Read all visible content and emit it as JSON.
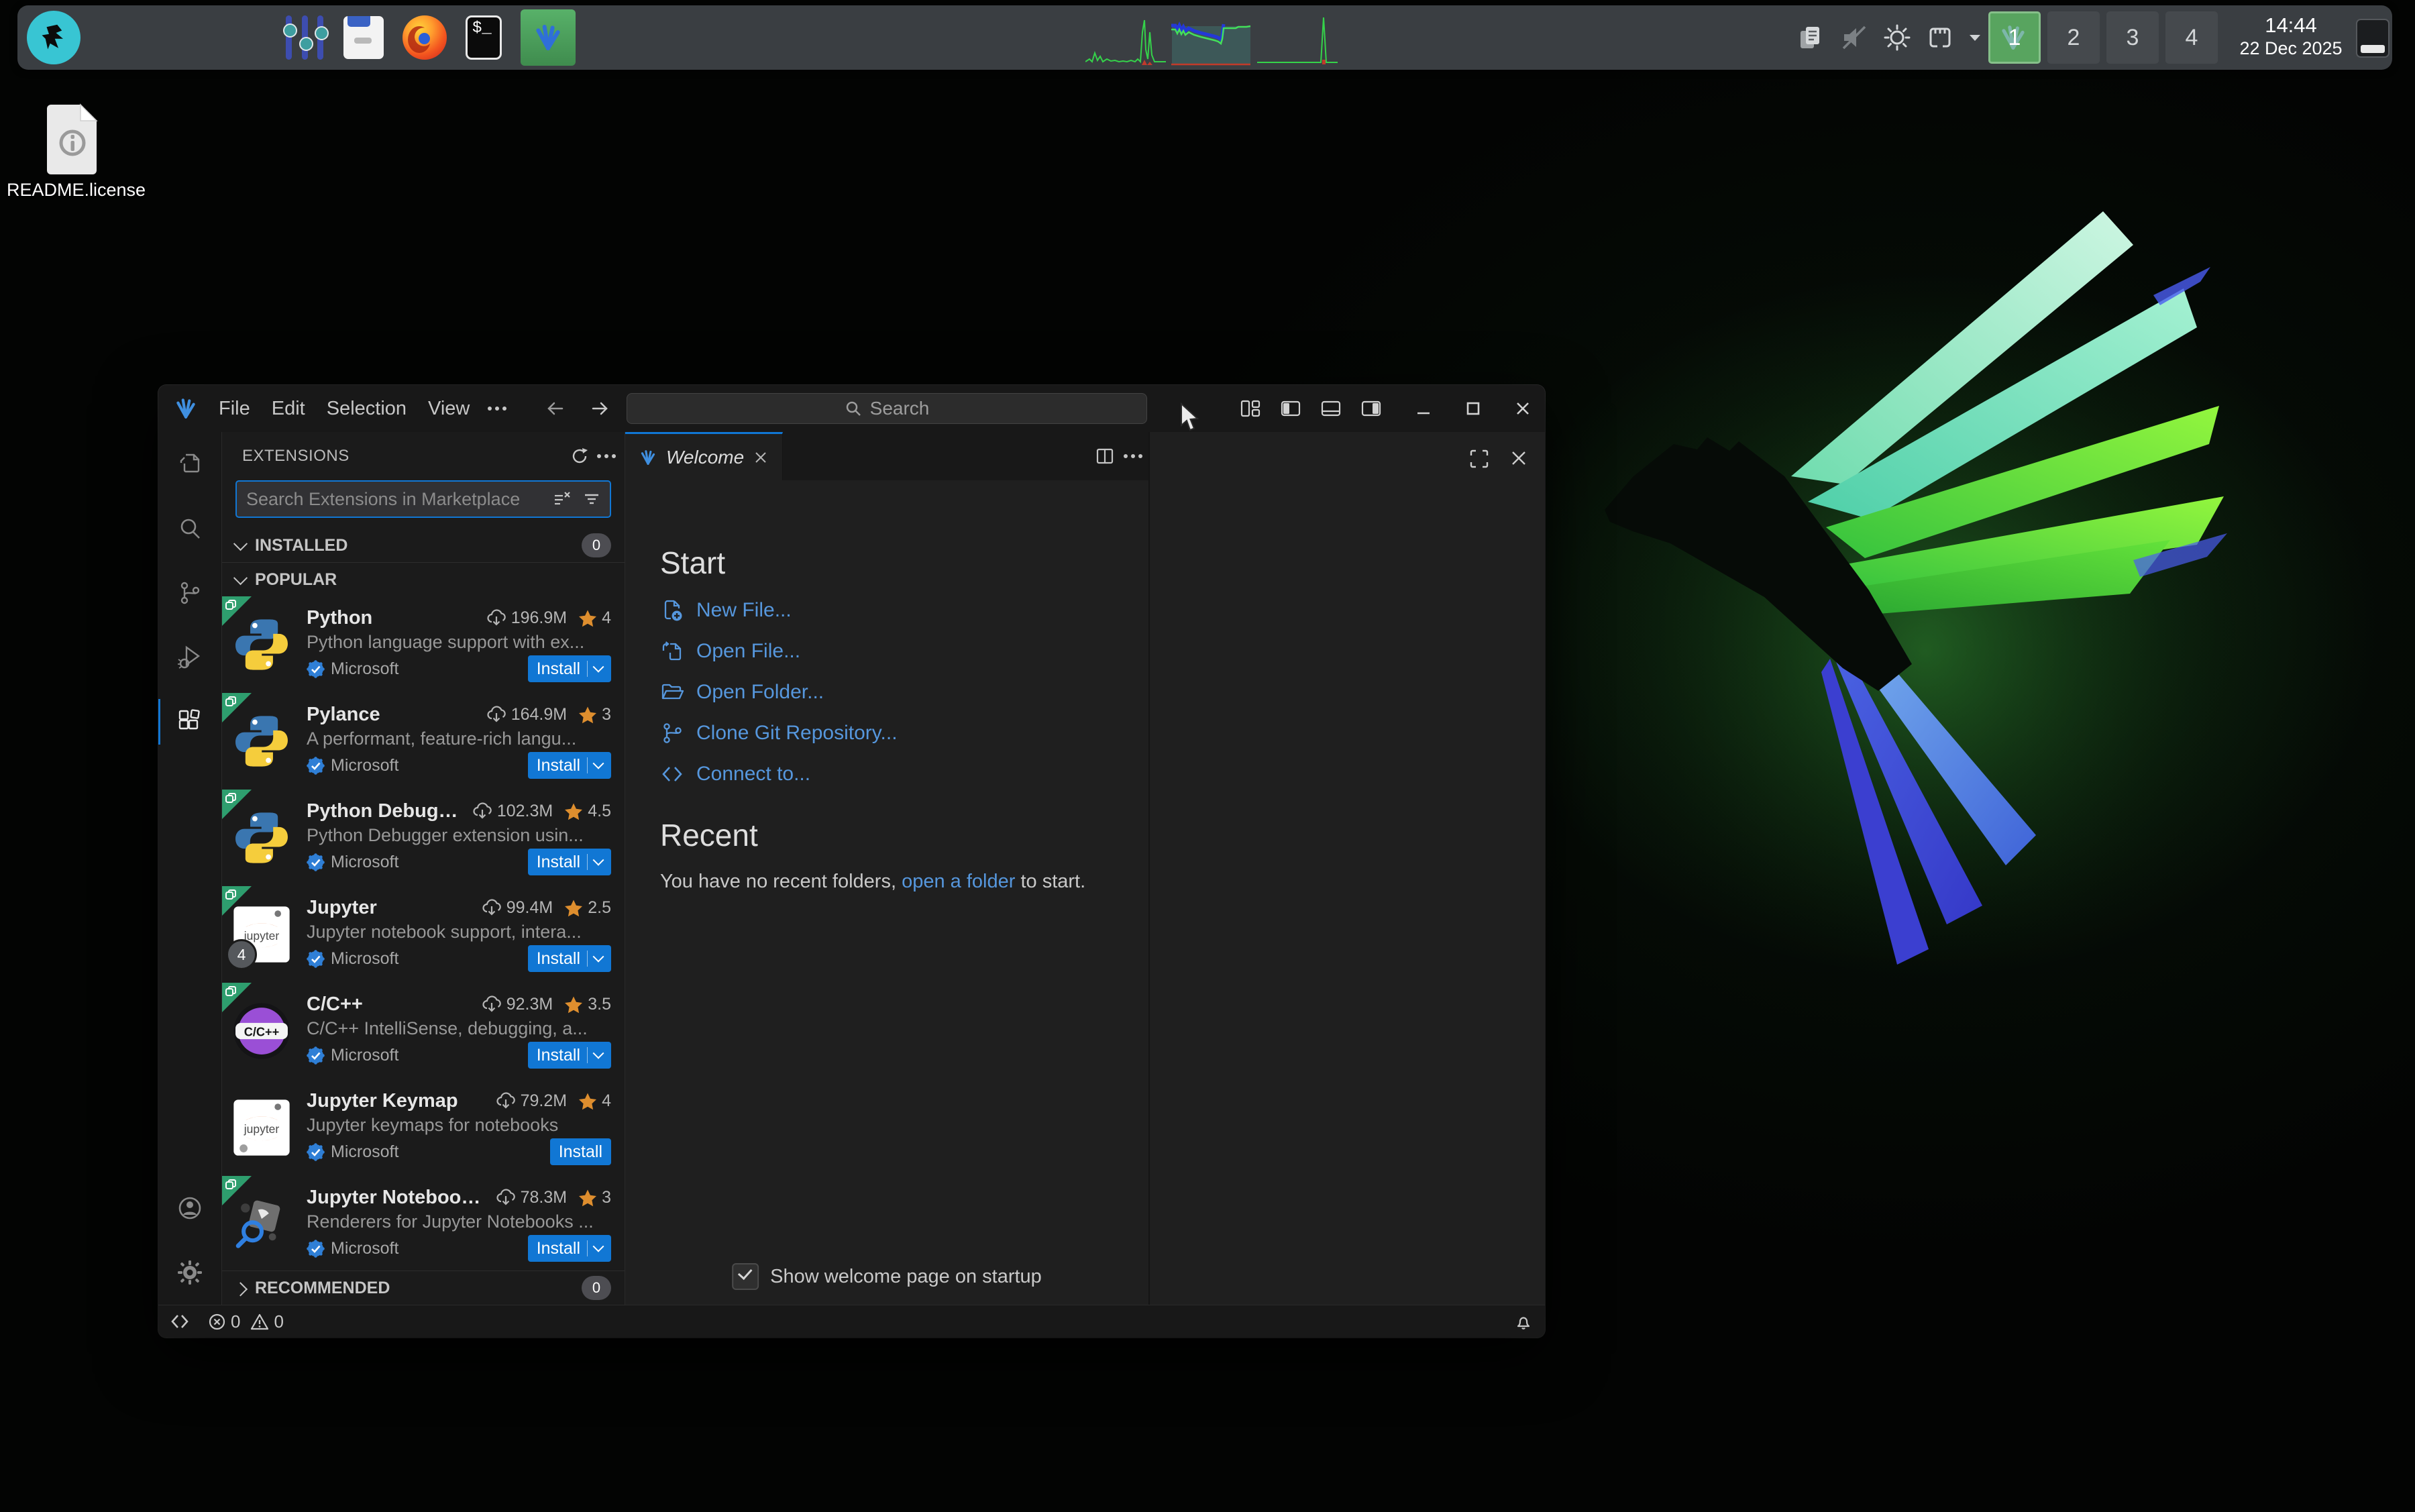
{
  "panel": {
    "clock_time": "14:44",
    "clock_date": "22 Dec 2025",
    "workspaces": [
      "1",
      "2",
      "3",
      "4"
    ],
    "active_workspace": "1",
    "terminal_glyph": "$_"
  },
  "desktop": {
    "readme_label": "README.license"
  },
  "window": {
    "menus": [
      "File",
      "Edit",
      "Selection",
      "View"
    ],
    "search_placeholder": "Search"
  },
  "welcome": {
    "tab_label": "Welcome",
    "start_title": "Start",
    "start_links": [
      {
        "label": "New File...",
        "icon": "new-file"
      },
      {
        "label": "Open File...",
        "icon": "open-file"
      },
      {
        "label": "Open Folder...",
        "icon": "open-folder"
      },
      {
        "label": "Clone Git Repository...",
        "icon": "git"
      },
      {
        "label": "Connect to...",
        "icon": "remote"
      }
    ],
    "recent_title": "Recent",
    "recent_text_pre": "You have no recent folders,",
    "recent_link": "open a folder",
    "recent_text_post": "to start.",
    "startup_checkbox_label": "Show welcome page on startup"
  },
  "extensions_panel": {
    "title": "EXTENSIONS",
    "search_placeholder": "Search Extensions in Marketplace",
    "installed_label": "INSTALLED",
    "installed_badge": "0",
    "popular_label": "POPULAR",
    "recommended_label": "RECOMMENDED",
    "recommended_badge": "0",
    "install_label": "Install",
    "items": [
      {
        "name": "Python",
        "downloads": "196.9M",
        "rating": "4",
        "desc": "Python language support with ex...",
        "publisher": "Microsoft",
        "icon": "python",
        "corner_badge": true,
        "has_dropdown": true
      },
      {
        "name": "Pylance",
        "downloads": "164.9M",
        "rating": "3",
        "desc": "A performant, feature-rich langu...",
        "publisher": "Microsoft",
        "icon": "python",
        "corner_badge": true,
        "has_dropdown": true
      },
      {
        "name": "Python Debugger",
        "downloads": "102.3M",
        "rating": "4.5",
        "desc": "Python Debugger extension usin...",
        "publisher": "Microsoft",
        "icon": "python",
        "corner_badge": true,
        "has_dropdown": true
      },
      {
        "name": "Jupyter",
        "downloads": "99.4M",
        "rating": "2.5",
        "desc": "Jupyter notebook support, intera...",
        "publisher": "Microsoft",
        "icon": "jupyter",
        "icon_text": "jupyter",
        "corner_badge": true,
        "has_dropdown": true,
        "count_badge": "4"
      },
      {
        "name": "C/C++",
        "downloads": "92.3M",
        "rating": "3.5",
        "desc": "C/C++ IntelliSense, debugging, a...",
        "publisher": "Microsoft",
        "icon": "cpp",
        "icon_text": "C/C++",
        "corner_badge": true,
        "has_dropdown": true
      },
      {
        "name": "Jupyter Keymap",
        "downloads": "79.2M",
        "rating": "4",
        "desc": "Jupyter keymaps for notebooks",
        "publisher": "Microsoft",
        "icon": "jupyter",
        "icon_text": "jupyter",
        "corner_badge": false,
        "has_dropdown": false
      },
      {
        "name": "Jupyter Notebook ...",
        "downloads": "78.3M",
        "rating": "3",
        "desc": "Renderers for Jupyter Notebooks ...",
        "publisher": "Microsoft",
        "icon": "jupyter-renderers",
        "corner_badge": true,
        "has_dropdown": true
      }
    ]
  },
  "status_bar": {
    "errors": "0",
    "warnings": "0"
  },
  "colors": {
    "accent_blue": "#1177d4",
    "workspace_green": "#58a45f",
    "rating_orange": "#de8e2e",
    "link_blue": "#5697dd",
    "remote_badge_green": "#2e9e6e"
  }
}
